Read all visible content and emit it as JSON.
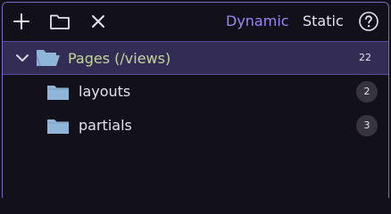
{
  "toolbar": {
    "icons": [
      "plus-icon",
      "folder-icon",
      "close-icon",
      "help-icon"
    ],
    "modes": {
      "dynamic_label": "Dynamic",
      "static_label": "Static",
      "active": "Dynamic"
    }
  },
  "tree": {
    "root": {
      "label": "Pages (/views)",
      "count": "22",
      "expanded": true
    },
    "children": [
      {
        "label": "layouts",
        "count": "2"
      },
      {
        "label": "partials",
        "count": "3"
      }
    ]
  },
  "colors": {
    "accent": "#9d86f5",
    "border": "#7b69c8",
    "root_row_bg": "#332d56",
    "root_label": "#c2d49c",
    "folder": "#8fb6d8",
    "background": "#121019"
  }
}
